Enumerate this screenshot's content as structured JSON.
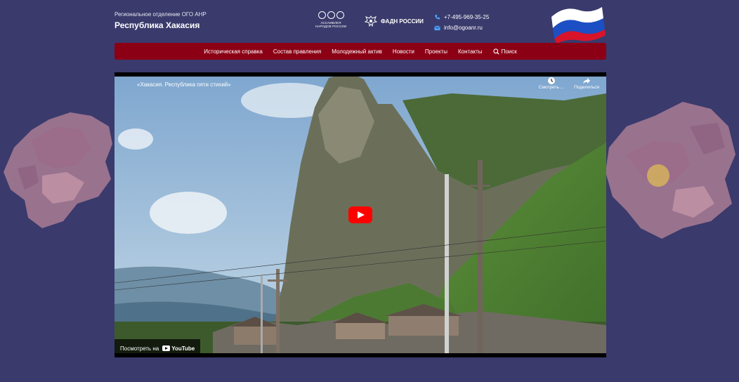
{
  "header": {
    "region_subtitle": "Региональное отделение ОГО АНР",
    "region_title": "Республика Хакасия",
    "assembly_caption_line1": "АССАМБЛЕЯ",
    "assembly_caption_line2": "НАРОДОВ РОССИИ",
    "fadn_label": "ФАДН РОССИИ",
    "phone": "+7-495-969-35-25",
    "email": "info@ogoanr.ru"
  },
  "nav": {
    "items": [
      {
        "label": "Историческая справка"
      },
      {
        "label": "Состав правления"
      },
      {
        "label": "Молодежный актив"
      },
      {
        "label": "Новости"
      },
      {
        "label": "Проекты"
      },
      {
        "label": "Контакты"
      }
    ],
    "search_label": "Поиск"
  },
  "video": {
    "title": "«Хакасия. Республика пяти стихий»",
    "watch_later_label": "Смотреть ...",
    "share_label": "Поделиться",
    "watch_on_label": "Посмотреть на",
    "youtube_label": "YouTube"
  },
  "colors": {
    "background": "#3a3a6c",
    "nav_background": "#8c0015",
    "play_button": "#ff0000"
  },
  "icons": [
    "assembly-logo-icon",
    "eagle-emblem-icon",
    "phone-icon",
    "mail-icon",
    "russian-flag-icon",
    "search-icon",
    "clock-icon",
    "share-icon",
    "play-icon",
    "youtube-logo-icon",
    "russia-map-left-icon",
    "russia-map-right-icon"
  ]
}
